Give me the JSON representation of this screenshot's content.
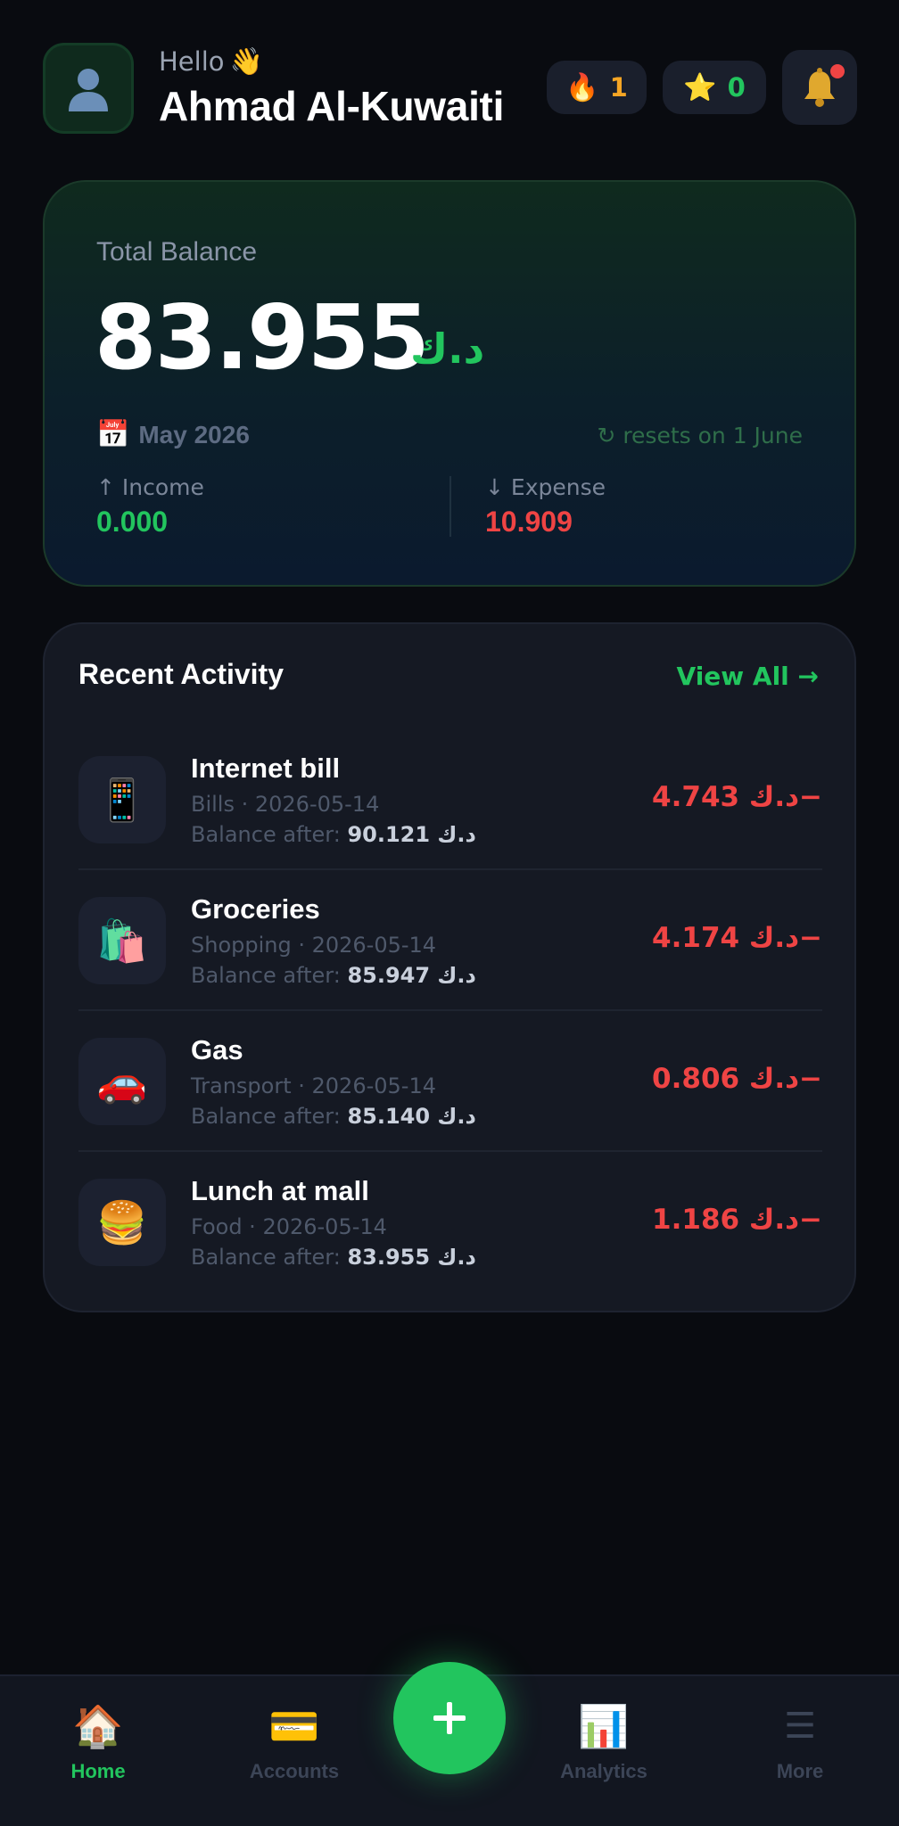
{
  "header": {
    "greeting": "Hello",
    "greeting_emoji": "👋",
    "user_name": "Ahmad Al-Kuwaiti",
    "streak": {
      "icon": "fire-icon",
      "glyph": "🔥",
      "value": "1"
    },
    "stars": {
      "icon": "star-icon",
      "glyph": "⭐",
      "value": "0"
    },
    "notifications": {
      "icon": "bell-icon",
      "has_unread": true
    }
  },
  "balance": {
    "label": "Total Balance",
    "amount": "83.955",
    "currency": "د.ك",
    "month_icon": "📅",
    "month": "May 2026",
    "reset_text": "↻ resets on 1 June",
    "income_label": "↑ Income",
    "income_value": "0.000",
    "expense_label": "↓ Expense",
    "expense_value": "10.909"
  },
  "activity": {
    "title": "Recent Activity",
    "view_all": "View All →",
    "balance_after_label": "Balance after:",
    "items": [
      {
        "name": "Internet bill",
        "meta": "Bills · 2026-05-14",
        "balance_after": "90.121 د.ك",
        "amount": "4.743 د.ك−",
        "icon": "📱",
        "icon_name": "mobile-phone-icon"
      },
      {
        "name": "Groceries",
        "meta": "Shopping · 2026-05-14",
        "balance_after": "85.947 د.ك",
        "amount": "4.174 د.ك−",
        "icon": "🛍️",
        "icon_name": "shopping-bags-icon"
      },
      {
        "name": "Gas",
        "meta": "Transport · 2026-05-14",
        "balance_after": "85.140 د.ك",
        "amount": "0.806 د.ك−",
        "icon": "🚗",
        "icon_name": "car-icon"
      },
      {
        "name": "Lunch at mall",
        "meta": "Food · 2026-05-14",
        "balance_after": "83.955 د.ك",
        "amount": "1.186 د.ك−",
        "icon": "🍔",
        "icon_name": "burger-icon"
      }
    ]
  },
  "nav": {
    "home": {
      "label": "Home",
      "glyph": "🏠"
    },
    "accounts": {
      "label": "Accounts",
      "glyph": "💳"
    },
    "add": {
      "icon": "plus-icon"
    },
    "analytics": {
      "label": "Analytics",
      "glyph": "📊"
    },
    "more": {
      "label": "More",
      "glyph": "☰"
    }
  },
  "colors": {
    "accent": "#22c55e",
    "expense": "#ef4444",
    "streak": "#f5a524",
    "background": "#090b10"
  }
}
